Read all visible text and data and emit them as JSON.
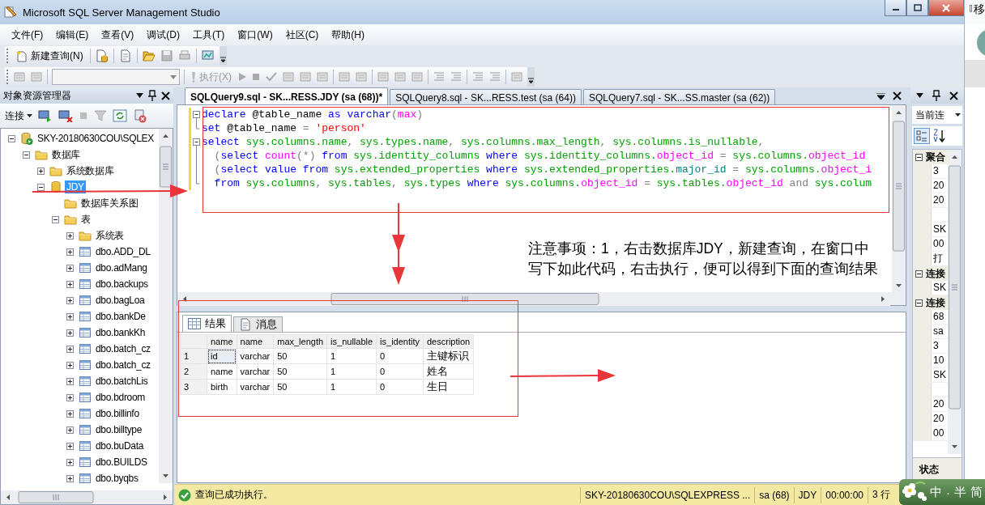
{
  "window": {
    "title": "Microsoft SQL Server Management Studio"
  },
  "menu": [
    "文件(F)",
    "编辑(E)",
    "查看(V)",
    "调试(D)",
    "工具(T)",
    "窗口(W)",
    "社区(C)",
    "帮助(H)"
  ],
  "toolbar": {
    "new_query": "新建查询(N)",
    "execute": {
      "label": "执行(X)",
      "disabled": true
    }
  },
  "explorer": {
    "title": "对象资源管理器",
    "connect": "连接",
    "tree": [
      {
        "label": "SKY-20180630COU\\SQLEX",
        "kind": "server",
        "expanded": true,
        "selected": false,
        "children": [
          {
            "label": "数据库",
            "kind": "folder",
            "expanded": true,
            "selected": false,
            "children": [
              {
                "label": "系统数据库",
                "kind": "folder",
                "expanded": false,
                "selected": false
              },
              {
                "label": "JDY",
                "kind": "database",
                "expanded": true,
                "selected": true,
                "children": [
                  {
                    "label": "数据库关系图",
                    "kind": "leaf-folder",
                    "selected": false
                  },
                  {
                    "label": "表",
                    "kind": "folder",
                    "expanded": true,
                    "selected": false,
                    "children": [
                      {
                        "label": "系统表",
                        "kind": "folder",
                        "expanded": false,
                        "selected": false
                      },
                      {
                        "label": "dbo.ADD_DL",
                        "kind": "table",
                        "expanded": false,
                        "selected": false
                      },
                      {
                        "label": "dbo.adMang",
                        "kind": "table",
                        "expanded": false,
                        "selected": false
                      },
                      {
                        "label": "dbo.backups",
                        "kind": "table",
                        "expanded": false,
                        "selected": false
                      },
                      {
                        "label": "dbo.bagLoa",
                        "kind": "table",
                        "expanded": false,
                        "selected": false
                      },
                      {
                        "label": "dbo.bankDe",
                        "kind": "table",
                        "expanded": false,
                        "selected": false
                      },
                      {
                        "label": "dbo.bankKh",
                        "kind": "table",
                        "expanded": false,
                        "selected": false
                      },
                      {
                        "label": "dbo.batch_cz",
                        "kind": "table",
                        "expanded": false,
                        "selected": false
                      },
                      {
                        "label": "dbo.batch_cz",
                        "kind": "table",
                        "expanded": false,
                        "selected": false
                      },
                      {
                        "label": "dbo.batchLis",
                        "kind": "table",
                        "expanded": false,
                        "selected": false
                      },
                      {
                        "label": "dbo.bdroom",
                        "kind": "table",
                        "expanded": false,
                        "selected": false
                      },
                      {
                        "label": "dbo.billinfo",
                        "kind": "table",
                        "expanded": false,
                        "selected": false
                      },
                      {
                        "label": "dbo.billtype",
                        "kind": "table",
                        "expanded": false,
                        "selected": false
                      },
                      {
                        "label": "dbo.buData",
                        "kind": "table",
                        "expanded": false,
                        "selected": false
                      },
                      {
                        "label": "dbo.BUILDS",
                        "kind": "table",
                        "expanded": false,
                        "selected": false
                      },
                      {
                        "label": "dbo.byqbs",
                        "kind": "table",
                        "expanded": false,
                        "selected": false
                      }
                    ]
                  }
                ]
              }
            ]
          }
        ]
      }
    ]
  },
  "editor": {
    "tabs": [
      {
        "label": "SQLQuery9.sql - SK...RESS.JDY (sa (68))*",
        "selected": true
      },
      {
        "label": "SQLQuery8.sql - SK...RESS.test (sa (64))",
        "selected": false
      },
      {
        "label": "SQLQuery7.sql - SK...SS.master (sa (62))",
        "selected": false
      }
    ],
    "lines": [
      {
        "foldable": true,
        "changed": true,
        "tokens": [
          {
            "kind": "kw",
            "text": "declare"
          },
          {
            "kind": "plain",
            "text": " @table_name "
          },
          {
            "kind": "kw",
            "text": "as "
          },
          {
            "kind": "kw",
            "text": "varchar"
          },
          {
            "kind": "op",
            "text": "("
          },
          {
            "kind": "fn",
            "text": "max"
          },
          {
            "kind": "op",
            "text": ")"
          }
        ]
      },
      {
        "foldable": false,
        "changed": true,
        "tokens": [
          {
            "kind": "kw",
            "text": "set"
          },
          {
            "kind": "plain",
            "text": " @table_name "
          },
          {
            "kind": "op",
            "text": "= "
          },
          {
            "kind": "str",
            "text": "'person'"
          }
        ]
      },
      {
        "foldable": true,
        "changed": true,
        "tokens": [
          {
            "kind": "kw",
            "text": "select "
          },
          {
            "kind": "sys",
            "text": "sys.columns.name"
          },
          {
            "kind": "op",
            "text": ", "
          },
          {
            "kind": "sys",
            "text": "sys.types.name"
          },
          {
            "kind": "op",
            "text": ", "
          },
          {
            "kind": "sys",
            "text": "sys.columns.max_length"
          },
          {
            "kind": "op",
            "text": ", "
          },
          {
            "kind": "sys",
            "text": "sys.columns.is_nullable"
          },
          {
            "kind": "op",
            "text": ","
          }
        ]
      },
      {
        "foldable": false,
        "changed": true,
        "tokens": [
          {
            "kind": "op",
            "text": "  ("
          },
          {
            "kind": "kw",
            "text": "select "
          },
          {
            "kind": "fn",
            "text": "count"
          },
          {
            "kind": "op",
            "text": "(*) "
          },
          {
            "kind": "kw",
            "text": "from "
          },
          {
            "kind": "sys",
            "text": "sys.identity_columns "
          },
          {
            "kind": "kw",
            "text": "where "
          },
          {
            "kind": "sys",
            "text": "sys.identity_columns."
          },
          {
            "kind": "fn",
            "text": "object_id"
          },
          {
            "kind": "op",
            "text": " = "
          },
          {
            "kind": "sys",
            "text": "sys.columns."
          },
          {
            "kind": "fn",
            "text": "object_id"
          }
        ]
      },
      {
        "foldable": false,
        "changed": true,
        "tokens": [
          {
            "kind": "op",
            "text": "  ("
          },
          {
            "kind": "kw",
            "text": "select value from "
          },
          {
            "kind": "sys",
            "text": "sys.extended_properties "
          },
          {
            "kind": "kw",
            "text": "where "
          },
          {
            "kind": "sys",
            "text": "sys.extended_properties."
          },
          {
            "kind": "col",
            "text": "major_id"
          },
          {
            "kind": "op",
            "text": " = "
          },
          {
            "kind": "sys",
            "text": "sys.columns."
          },
          {
            "kind": "fn",
            "text": "object_i"
          }
        ]
      },
      {
        "foldable": false,
        "changed": true,
        "tokens": [
          {
            "kind": "kw",
            "text": "  from "
          },
          {
            "kind": "sys",
            "text": "sys.columns"
          },
          {
            "kind": "op",
            "text": ", "
          },
          {
            "kind": "sys",
            "text": "sys.tables"
          },
          {
            "kind": "op",
            "text": ", "
          },
          {
            "kind": "sys",
            "text": "sys.types "
          },
          {
            "kind": "kw",
            "text": "where "
          },
          {
            "kind": "sys",
            "text": "sys.columns."
          },
          {
            "kind": "fn",
            "text": "object_id"
          },
          {
            "kind": "op",
            "text": " = "
          },
          {
            "kind": "sys",
            "text": "sys.tables."
          },
          {
            "kind": "fn",
            "text": "object_id"
          },
          {
            "kind": "op",
            "text": " and "
          },
          {
            "kind": "sys",
            "text": "sys.colum"
          }
        ]
      }
    ]
  },
  "results": {
    "tabs": [
      {
        "label": "结果",
        "kind": "grid",
        "selected": true
      },
      {
        "label": "消息",
        "kind": "messages",
        "selected": false
      }
    ],
    "columns": [
      "name",
      "name",
      "max_length",
      "is_nullable",
      "is_identity",
      "description"
    ],
    "rows": [
      {
        "number": "1",
        "focused": true,
        "cells": [
          "id",
          "varchar",
          "50",
          "1",
          "0",
          "主键标识"
        ]
      },
      {
        "number": "2",
        "focused": false,
        "cells": [
          "name",
          "varchar",
          "50",
          "1",
          "0",
          "姓名"
        ]
      },
      {
        "number": "3",
        "focused": false,
        "cells": [
          "birth",
          "varchar",
          "50",
          "1",
          "0",
          "生日"
        ]
      }
    ]
  },
  "properties": {
    "dropdown": "当前连",
    "sections": [
      {
        "title": "聚合",
        "expanded": true,
        "rows": [
          {
            "kind": "text",
            "value": "3"
          },
          {
            "kind": "text",
            "value": "20"
          },
          {
            "kind": "text",
            "value": "20"
          },
          {
            "kind": "blank"
          },
          {
            "kind": "text",
            "value": "SK"
          },
          {
            "kind": "text",
            "value": "00"
          },
          {
            "kind": "text",
            "value": "打"
          }
        ]
      },
      {
        "title": "连接",
        "expanded": true,
        "rows": [
          {
            "kind": "text",
            "value": "SK"
          }
        ]
      },
      {
        "title": "连接",
        "expanded": true,
        "rows": [
          {
            "kind": "text",
            "value": "68"
          },
          {
            "kind": "text",
            "value": "sa"
          },
          {
            "kind": "text",
            "value": "3"
          },
          {
            "kind": "text",
            "value": "10"
          },
          {
            "kind": "text",
            "value": "SK"
          },
          {
            "kind": "blank"
          },
          {
            "kind": "text",
            "value": "20"
          },
          {
            "kind": "text",
            "value": "20"
          },
          {
            "kind": "text",
            "value": "00"
          }
        ]
      }
    ],
    "footer": "状态"
  },
  "status_bar": {
    "message": "查询已成功执行。",
    "fields": [
      "SKY-20180630COU\\SQLEXPRESS ...",
      "sa (68)",
      "JDY",
      "00:00:00",
      "3 行"
    ]
  },
  "background_window": {
    "title": "移"
  },
  "ime": [
    "中",
    "·",
    "半",
    "简"
  ],
  "annotation": {
    "note": [
      "注意事项：1，右击数据库JDY，新建查询，在窗口中",
      "写下如此代码，右击执行，便可以得到下面的查询结果"
    ]
  }
}
